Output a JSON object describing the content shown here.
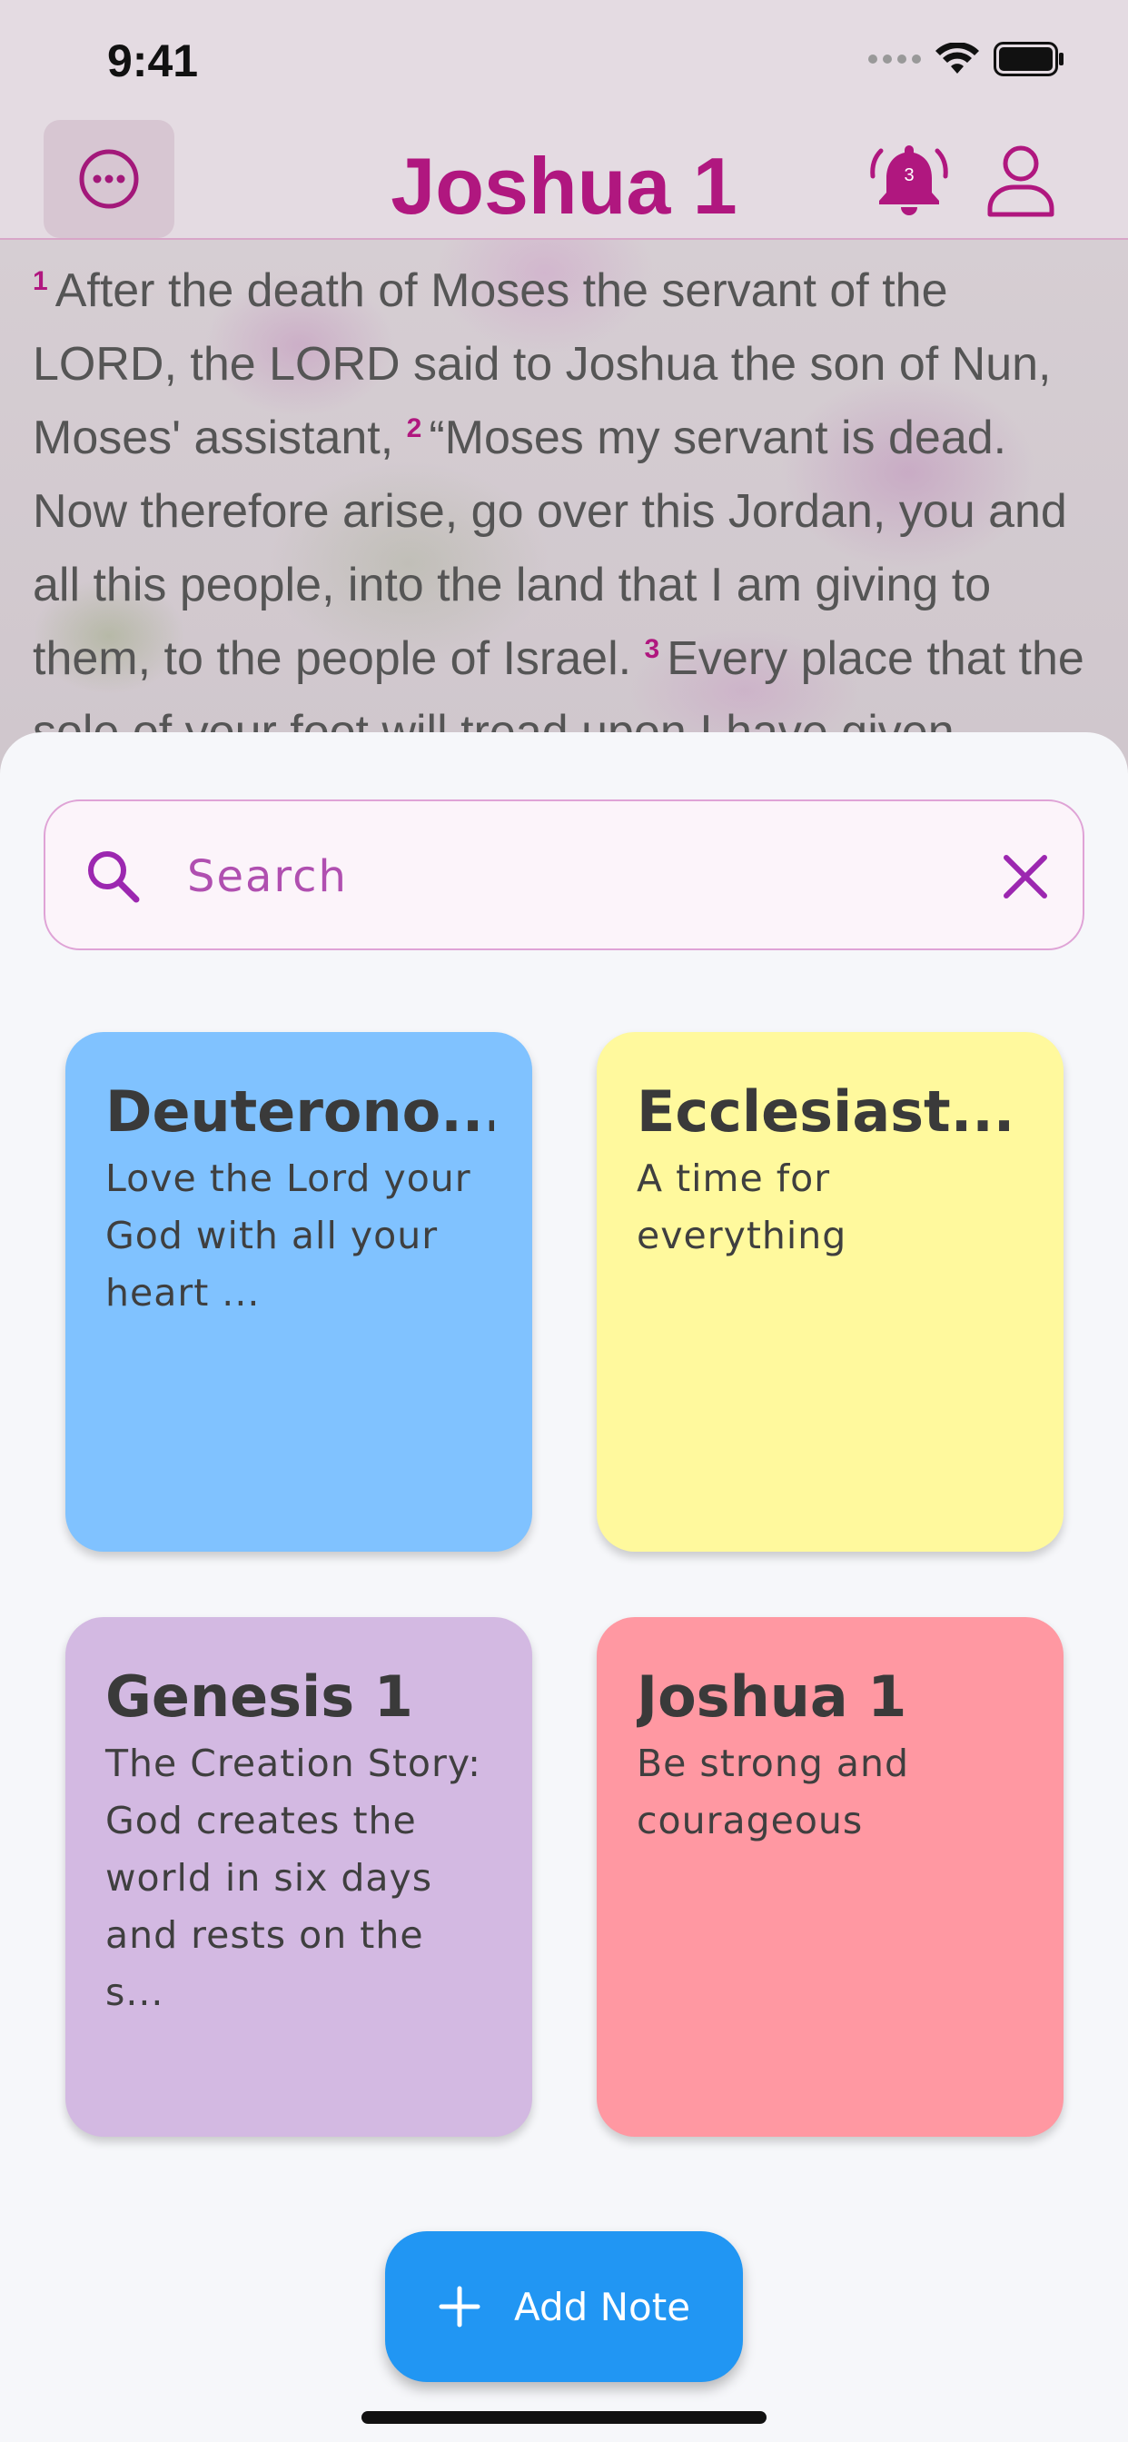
{
  "status_bar": {
    "time": "9:41"
  },
  "app_bar": {
    "title": "Joshua 1",
    "notification_count": "3",
    "menu_icon": "ellipsis-circle-icon",
    "bell_icon": "bell-ringing-icon",
    "profile_icon": "person-icon"
  },
  "scripture": {
    "verses": [
      {
        "num": "1",
        "text": "After the death of Moses the servant of the LORD, the LORD said to Joshua the son of Nun, Moses' assistant,"
      },
      {
        "num": "2",
        "text": "“Moses my servant is dead. Now therefore arise, go over this Jordan, you and all this people, into the land that I am giving to them, to the people of Israel."
      },
      {
        "num": "3",
        "text": "Every place that the sole of your foot will tread upon I have given"
      }
    ]
  },
  "search": {
    "placeholder": "Search",
    "value": ""
  },
  "notes": [
    {
      "title": "Deuterono...",
      "body": "Love the Lord your God with all your heart ...",
      "color": "#80c2ff"
    },
    {
      "title": "Ecclesiast...",
      "body": "A time for everything",
      "color": "#fff99d"
    },
    {
      "title": "Genesis 1",
      "body": "The Creation Story: God creates the world in six days and rests on the s...",
      "color": "#d3b9e2"
    },
    {
      "title": "Joshua 1",
      "body": "Be strong and courageous",
      "color": "#ff98a2"
    }
  ],
  "add_note": {
    "label": "Add Note"
  },
  "colors": {
    "accent": "#b0177f",
    "search_accent": "#9c27b0",
    "fab": "#2196f3"
  }
}
